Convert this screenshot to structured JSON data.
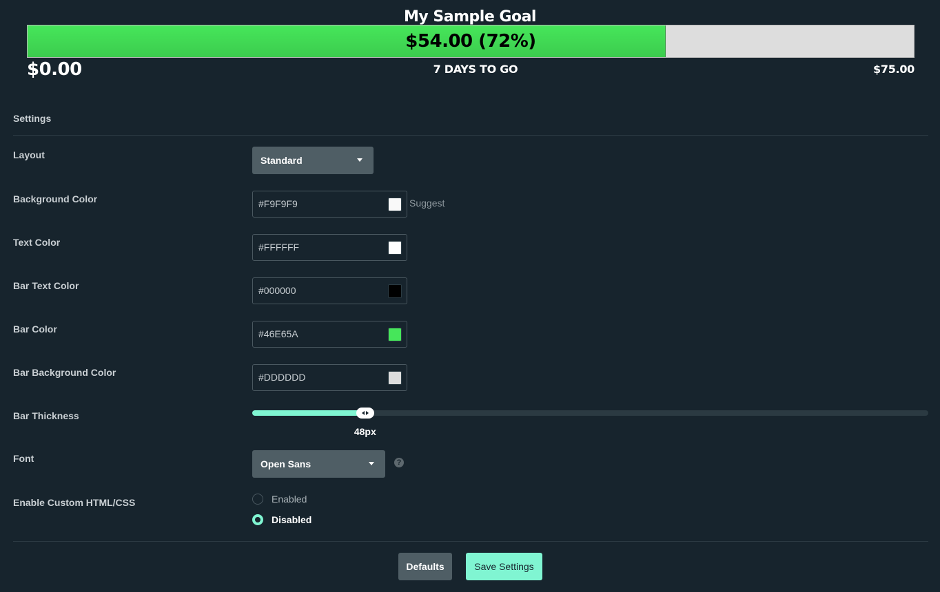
{
  "goal": {
    "title": "My Sample Goal",
    "bar_text": "$54.00 (72%)",
    "current_amount": "$54.00",
    "progress_percent": 72,
    "start_label": "$0.00",
    "days_label": "7 DAYS TO GO",
    "end_label": "$75.00"
  },
  "settings": {
    "section_title": "Settings",
    "layout": {
      "label": "Layout",
      "value": "Standard"
    },
    "background_color": {
      "label": "Background Color",
      "value": "#F9F9F9",
      "swatch": "#F9F9F9",
      "suggest_label": "Suggest"
    },
    "text_color": {
      "label": "Text Color",
      "value": "#FFFFFF",
      "swatch": "#FFFFFF"
    },
    "bar_text_color": {
      "label": "Bar Text Color",
      "value": "#000000",
      "swatch": "#000000"
    },
    "bar_color": {
      "label": "Bar Color",
      "value": "#46E65A",
      "swatch": "#46E65A"
    },
    "bar_background_color": {
      "label": "Bar Background Color",
      "value": "#DDDDDD",
      "swatch": "#DDDDDD"
    },
    "bar_thickness": {
      "label": "Bar Thickness",
      "value_label": "48px",
      "fraction": 0.167
    },
    "font": {
      "label": "Font",
      "value": "Open Sans",
      "help_icon": "question-circle-icon"
    },
    "custom_html": {
      "label": "Enable Custom HTML/CSS",
      "options": [
        {
          "label": "Enabled",
          "checked": false
        },
        {
          "label": "Disabled",
          "checked": true
        }
      ]
    }
  },
  "buttons": {
    "defaults": "Defaults",
    "save": "Save Settings"
  },
  "colors": {
    "accent": "#80F5D2",
    "page_background": "#17242D",
    "bar_fill": "#46E65A",
    "bar_background": "#DDDDDD"
  }
}
